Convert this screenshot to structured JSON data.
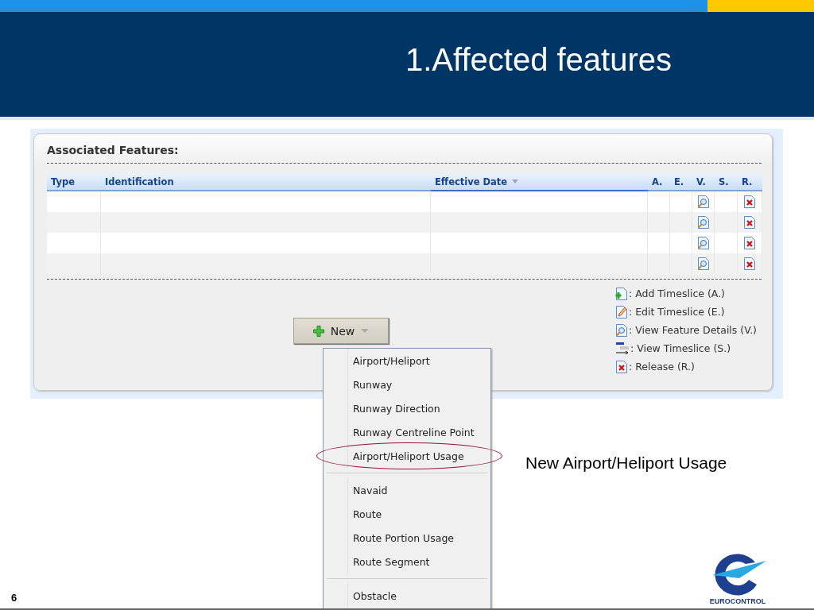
{
  "slide": {
    "title": "1.Affected features",
    "caption": "New Airport/Heliport Usage",
    "page_number": "6",
    "logo_text": "EUROCONTROL"
  },
  "panel": {
    "title": "Associated Features:",
    "columns": [
      {
        "label": "Type",
        "sorted": false
      },
      {
        "label": "Identification",
        "sorted": false
      },
      {
        "label": "Effective Date",
        "sorted": true
      },
      {
        "label": "A.",
        "sorted": false
      },
      {
        "label": "E.",
        "sorted": false
      },
      {
        "label": "V.",
        "sorted": false
      },
      {
        "label": "S.",
        "sorted": false
      },
      {
        "label": "R.",
        "sorted": false
      }
    ],
    "rows": [
      {
        "selected": false
      },
      {
        "selected": false
      },
      {
        "selected": false
      },
      {
        "selected": false
      }
    ],
    "legend": [
      {
        "kind": "add",
        "text": ": Add Timeslice (A.)"
      },
      {
        "kind": "edit",
        "text": ": Edit Timeslice (E.)"
      },
      {
        "kind": "view",
        "text": ": View Feature Details (V.)"
      },
      {
        "kind": "timeslice",
        "text": ": View Timeslice (S.)"
      },
      {
        "kind": "release",
        "text": ": Release (R.)"
      }
    ],
    "new_button": {
      "label": "New"
    }
  },
  "menu": {
    "groups": [
      [
        {
          "label": "Airport/Heliport",
          "circled": false
        },
        {
          "label": "Runway",
          "circled": false
        },
        {
          "label": "Runway Direction",
          "circled": false
        },
        {
          "label": "Runway Centreline Point",
          "circled": false
        },
        {
          "label": "Airport/Heliport Usage",
          "circled": true
        }
      ],
      [
        {
          "label": "Navaid",
          "circled": false
        },
        {
          "label": "Route",
          "circled": false
        },
        {
          "label": "Route Portion Usage",
          "circled": false
        },
        {
          "label": "Route Segment",
          "circled": false
        }
      ],
      [
        {
          "label": "Obstacle",
          "circled": false
        }
      ]
    ]
  }
}
